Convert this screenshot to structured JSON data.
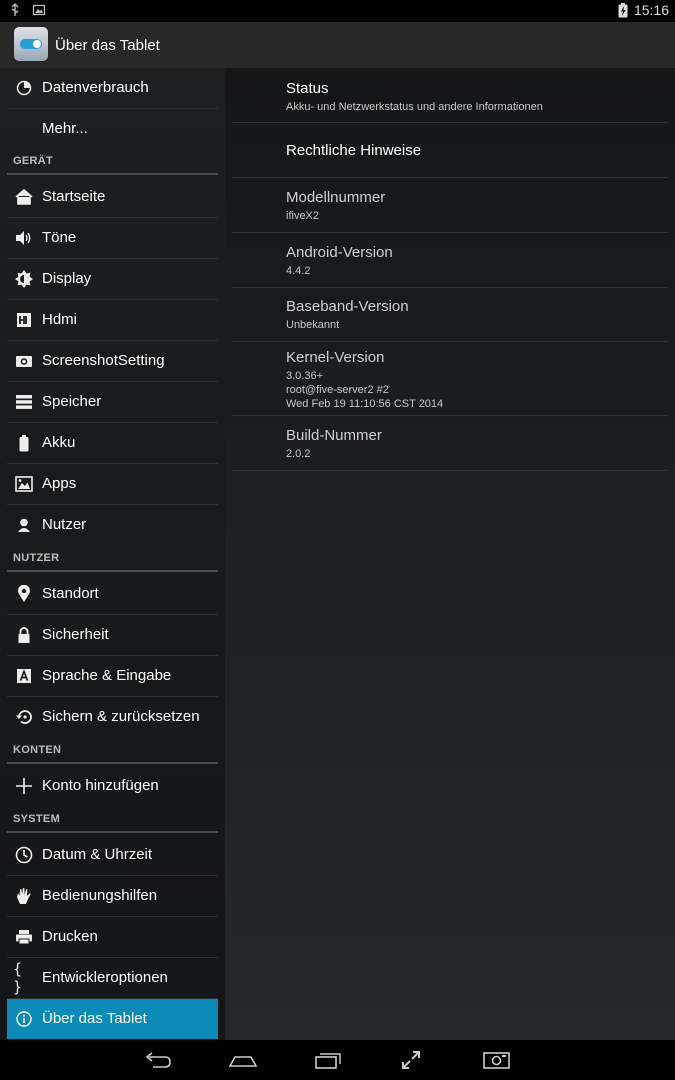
{
  "status_bar": {
    "time": "15:16"
  },
  "action_bar": {
    "title": "Über das Tablet"
  },
  "sidebar": {
    "top_items": [
      {
        "label": "Datenverbrauch",
        "icon": "data-usage-icon"
      },
      {
        "label": "Mehr...",
        "icon": ""
      }
    ],
    "sections": [
      {
        "header": "GERÄT",
        "items": [
          {
            "label": "Startseite",
            "icon": "home-icon"
          },
          {
            "label": "Töne",
            "icon": "volume-icon"
          },
          {
            "label": "Display",
            "icon": "brightness-icon"
          },
          {
            "label": "Hdmi",
            "icon": "hdmi-icon"
          },
          {
            "label": "ScreenshotSetting",
            "icon": "camera-icon"
          },
          {
            "label": "Speicher",
            "icon": "storage-icon"
          },
          {
            "label": "Akku",
            "icon": "battery-icon"
          },
          {
            "label": "Apps",
            "icon": "apps-icon"
          },
          {
            "label": "Nutzer",
            "icon": "user-icon"
          }
        ]
      },
      {
        "header": "NUTZER",
        "items": [
          {
            "label": "Standort",
            "icon": "location-icon"
          },
          {
            "label": "Sicherheit",
            "icon": "lock-icon"
          },
          {
            "label": "Sprache & Eingabe",
            "icon": "language-icon"
          },
          {
            "label": "Sichern & zurücksetzen",
            "icon": "backup-icon"
          }
        ]
      },
      {
        "header": "KONTEN",
        "items": [
          {
            "label": "Konto hinzufügen",
            "icon": "add-icon"
          }
        ]
      },
      {
        "header": "SYSTEM",
        "items": [
          {
            "label": "Datum & Uhrzeit",
            "icon": "clock-icon"
          },
          {
            "label": "Bedienungshilfen",
            "icon": "accessibility-icon"
          },
          {
            "label": "Drucken",
            "icon": "print-icon"
          },
          {
            "label": "Entwickleroptionen",
            "icon": "developer-icon"
          },
          {
            "label": "Über das Tablet",
            "icon": "info-icon",
            "active": true
          }
        ]
      }
    ]
  },
  "main": {
    "items": [
      {
        "title": "Status",
        "subtitle": "Akku- und Netzwerkstatus und andere Informationen"
      },
      {
        "title": "Rechtliche Hinweise",
        "subtitle": ""
      },
      {
        "title": "Modellnummer",
        "subtitle": "ifiveX2"
      },
      {
        "title": "Android-Version",
        "subtitle": "4.4.2"
      },
      {
        "title": "Baseband-Version",
        "subtitle": "Unbekannt"
      },
      {
        "title": "Kernel-Version",
        "subtitle": "3.0.36+\nroot@five-server2 #2\nWed Feb 19 11:10:56 CST 2014"
      },
      {
        "title": "Build-Nummer",
        "subtitle": "2.0.2"
      }
    ]
  },
  "colors": {
    "accent": "#0b8ab8",
    "sidebar_bg": "#1c1e20",
    "action_bar_bg": "#282828"
  }
}
